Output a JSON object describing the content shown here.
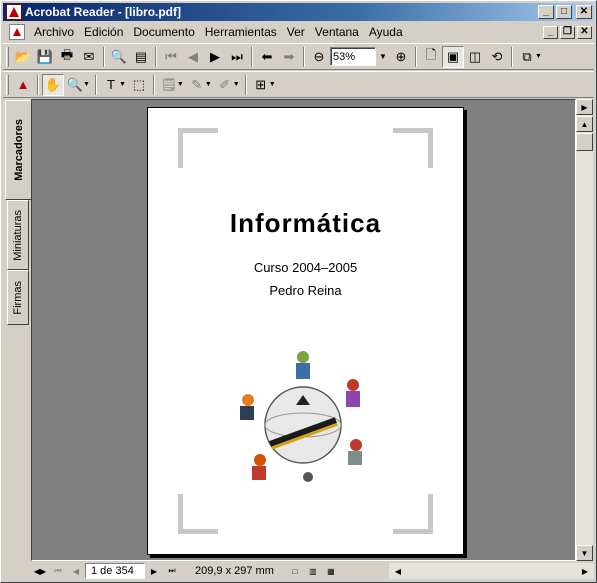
{
  "window": {
    "title": "Acrobat Reader - [libro.pdf]"
  },
  "menu": {
    "items": [
      "Archivo",
      "Edición",
      "Documento",
      "Herramientas",
      "Ver",
      "Ventana",
      "Ayuda"
    ]
  },
  "toolbar": {
    "zoom_value": "53%"
  },
  "sidebar": {
    "tabs": [
      "Marcadores",
      "Miniaturas",
      "Firmas"
    ]
  },
  "document": {
    "title": "Informática",
    "course": "Curso 2004–2005",
    "author": "Pedro Reina"
  },
  "statusbar": {
    "page_indicator": "1 de 354",
    "page_size": "209,9 x 297 mm"
  }
}
